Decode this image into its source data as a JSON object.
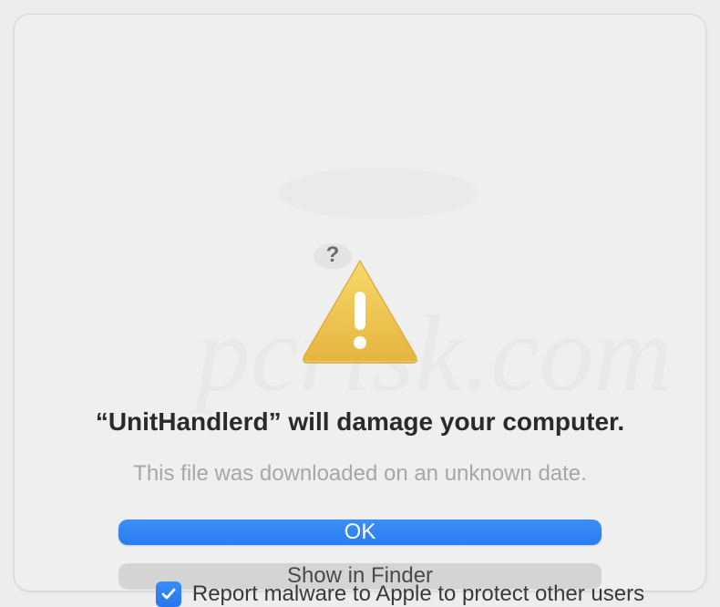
{
  "dialog": {
    "help_symbol": "?",
    "title": "“UnitHandlerd” will damage your computer.",
    "subtitle": "This file was downloaded on an unknown date.",
    "primary_button": "OK",
    "secondary_button": "Show in Finder",
    "checkbox_label": "Report malware to Apple to protect other users",
    "checkbox_checked": true
  }
}
